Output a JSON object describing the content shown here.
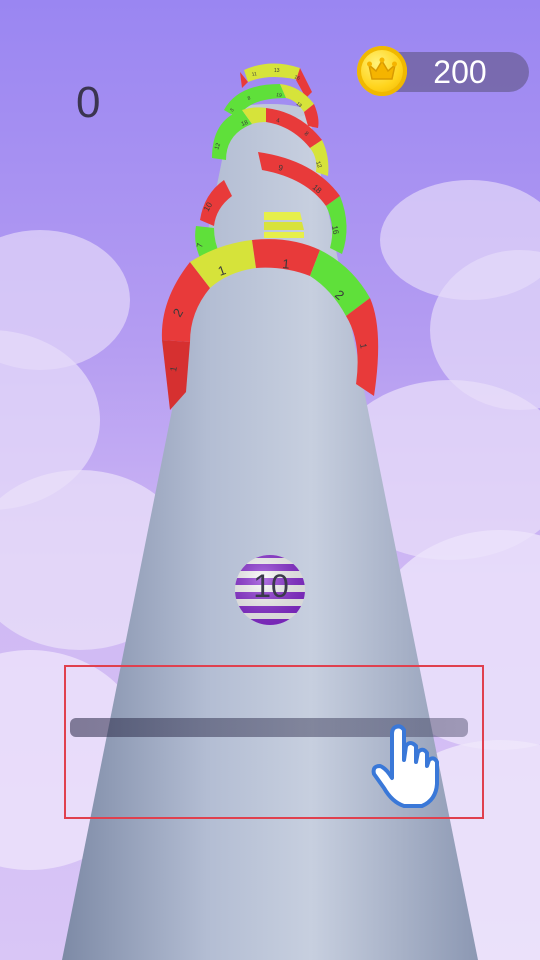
{
  "hud": {
    "score": "0",
    "coin_count": "200",
    "coin_icon": "crown-coin-icon"
  },
  "player_ball": {
    "number": "10",
    "colors": [
      "#8a2bd6",
      "#ffffff"
    ]
  },
  "rings": [
    {
      "segments": [
        {
          "label": "1",
          "color": "#e83a3a"
        },
        {
          "label": "2",
          "color": "#e83a3a"
        },
        {
          "label": "1",
          "color": "#d6e33a"
        },
        {
          "label": "1",
          "color": "#e83a3a"
        },
        {
          "label": "2",
          "color": "#5fe03a"
        },
        {
          "label": "1",
          "color": "#e83a3a"
        }
      ]
    },
    {
      "segments": [
        {
          "label": "7",
          "color": "#5fe03a"
        },
        {
          "label": "10",
          "color": "#e83a3a"
        }
      ]
    },
    {
      "segments": [
        {
          "label": "9",
          "color": "#e83a3a"
        },
        {
          "label": "18",
          "color": "#e83a3a"
        },
        {
          "label": "16",
          "color": "#5fe03a"
        }
      ]
    },
    {
      "segments": [
        {
          "label": "12",
          "color": "#5fe03a"
        },
        {
          "label": "18",
          "color": "#d6e33a"
        },
        {
          "label": "4",
          "color": "#e83a3a"
        },
        {
          "label": "8",
          "color": "#e83a3a"
        },
        {
          "label": "12",
          "color": "#d6e33a"
        }
      ]
    },
    {
      "segments": [
        {
          "label": "5",
          "color": "#5fe03a"
        },
        {
          "label": "8",
          "color": "#5fe03a"
        },
        {
          "label": "19",
          "color": "#d6e33a"
        },
        {
          "label": "18",
          "color": "#e83a3a"
        }
      ]
    },
    {
      "segments": [
        {
          "label": "11",
          "color": "#e83a3a"
        },
        {
          "label": "13",
          "color": "#d6e33a"
        },
        {
          "label": "16",
          "color": "#d6e33a"
        }
      ]
    }
  ],
  "pickup_stack": {
    "color": "#e6ef4a"
  },
  "tutorial": {
    "frame_color": "#e0404e",
    "hand_icon": "pointing-hand-icon"
  },
  "colors": {
    "sky_top": "#9a86f2",
    "sky_bottom": "#d9c6f6",
    "tower": "#a9b4cc",
    "coin": "#ffd31a"
  }
}
